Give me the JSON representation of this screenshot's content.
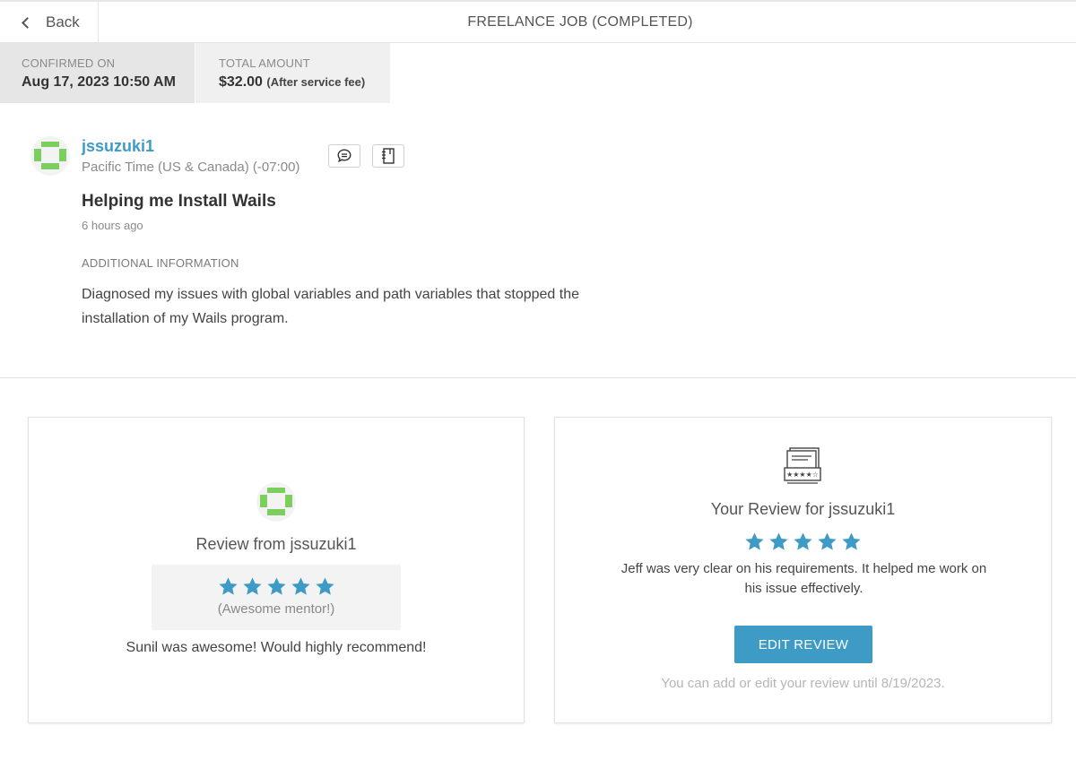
{
  "header": {
    "back_label": "Back",
    "title": "FREELANCE JOB (COMPLETED)"
  },
  "summary": {
    "confirmed_label": "CONFIRMED ON",
    "confirmed_value": "Aug 17, 2023 10:50 AM",
    "total_label": "TOTAL AMOUNT",
    "total_value": "$32.00",
    "total_note": "(After service fee)"
  },
  "job": {
    "username": "jssuzuki1",
    "timezone": "Pacific Time (US & Canada) (-07:00)",
    "title": "Helping me Install Wails",
    "posted_ago": "6 hours ago",
    "additional_label": "ADDITIONAL INFORMATION",
    "description_line1": "Diagnosed my issues with global variables and path variables that stopped the",
    "description_line2": "installation of my Wails program."
  },
  "review_from": {
    "title": "Review from jssuzuki1",
    "rating": 5,
    "rating_note": "(Awesome mentor!)",
    "comment": "Sunil was awesome! Would highly recommend!"
  },
  "your_review": {
    "title": "Your Review for jssuzuki1",
    "rating": 5,
    "comment_line1": "Jeff was very clear on his requirements. It helped me work on",
    "comment_line2": "his issue effectively.",
    "edit_button": "EDIT REVIEW",
    "edit_note": "You can add or edit your review until 8/19/2023."
  },
  "icons": {
    "back": "chevron-left-icon",
    "chat": "chat-bubble-icon",
    "notes": "notebook-icon",
    "review_doc": "review-document-icon",
    "star": "star-icon"
  },
  "colors": {
    "accent": "#3d9bc5",
    "avatar_green": "#7ccf5f",
    "muted_text": "#8a8a8a"
  }
}
